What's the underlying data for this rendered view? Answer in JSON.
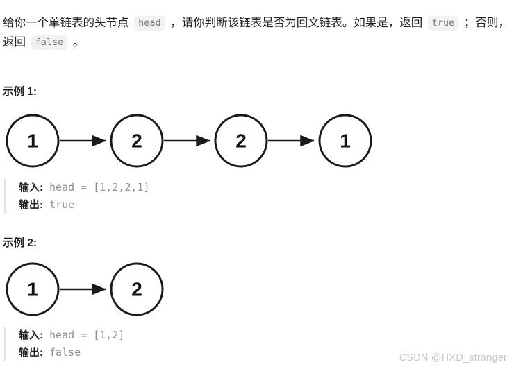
{
  "statement": {
    "seg1": "给你一个单链表的头节点 ",
    "code1": "head",
    "seg2": " ，请你判断该链表是否为回文链表。如果是，返回 ",
    "code2": "true",
    "seg3": " ；否则，返回 ",
    "code3": "false",
    "seg4": " 。"
  },
  "examples": [
    {
      "heading": "示例 1:",
      "nodes": [
        "1",
        "2",
        "2",
        "1"
      ],
      "input_label": "输入:",
      "input_value": " head = [1,2,2,1]",
      "output_label": "输出:",
      "output_value": " true"
    },
    {
      "heading": "示例 2:",
      "nodes": [
        "1",
        "2"
      ],
      "input_label": "输入:",
      "input_value": " head = [1,2]",
      "output_label": "输出:",
      "output_value": " false"
    }
  ],
  "watermark": "CSDN @HXD_stranger",
  "colors": {
    "node_stroke": "#1a1a1a",
    "node_fill": "#ffffff",
    "arrow": "#1a1a1a",
    "code_bg": "#f2f2f2",
    "code_text": "#6e7781",
    "io_text": "#8a9099",
    "quote_bar": "#e3e4e6",
    "watermark": "#c8c8c8"
  }
}
